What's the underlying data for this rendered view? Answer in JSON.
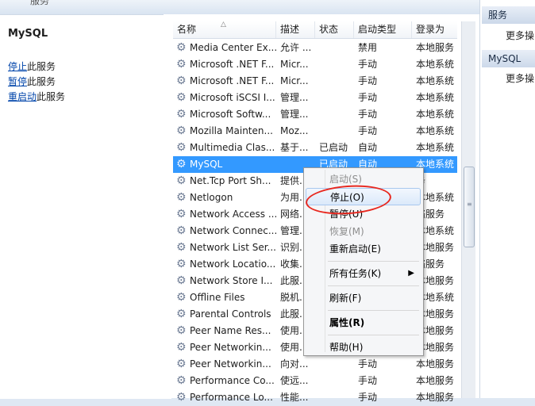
{
  "topbar": {
    "title": "服务"
  },
  "left": {
    "service_name": "MySQL",
    "actions": [
      {
        "link": "停止",
        "rest": "此服务"
      },
      {
        "link": "暂停",
        "rest": "此服务"
      },
      {
        "link": "重启动",
        "rest": "此服务"
      }
    ]
  },
  "columns": [
    "名称",
    "描述",
    "状态",
    "启动类型",
    "登录为"
  ],
  "rows": [
    {
      "name": "Media Center Ex...",
      "desc": "允许 ...",
      "status": "",
      "startup": "禁用",
      "logon": "本地服务"
    },
    {
      "name": "Microsoft .NET F...",
      "desc": "Micr...",
      "status": "",
      "startup": "手动",
      "logon": "本地系统"
    },
    {
      "name": "Microsoft .NET F...",
      "desc": "Micr...",
      "status": "",
      "startup": "手动",
      "logon": "本地系统"
    },
    {
      "name": "Microsoft iSCSI I...",
      "desc": "管理...",
      "status": "",
      "startup": "手动",
      "logon": "本地系统"
    },
    {
      "name": "Microsoft Softw...",
      "desc": "管理...",
      "status": "",
      "startup": "手动",
      "logon": "本地系统"
    },
    {
      "name": "Mozilla Mainten...",
      "desc": "Moz...",
      "status": "",
      "startup": "手动",
      "logon": "本地系统"
    },
    {
      "name": "Multimedia Clas...",
      "desc": "基于...",
      "status": "已启动",
      "startup": "自动",
      "logon": "本地系统"
    },
    {
      "name": "MySQL",
      "desc": "",
      "status": "已启动",
      "startup": "自动",
      "logon": "本地系统",
      "selected": true
    },
    {
      "name": "Net.Tcp Port Sh...",
      "desc": "提供...",
      "status": "",
      "startup": "",
      "logon": "务"
    },
    {
      "name": "Netlogon",
      "desc": "为用...",
      "status": "",
      "startup": "",
      "logon": "本地系统"
    },
    {
      "name": "Network Access ...",
      "desc": "网络...",
      "status": "",
      "startup": "",
      "logon": "络服务"
    },
    {
      "name": "Network Connec...",
      "desc": "管理...",
      "status": "",
      "startup": "",
      "logon": "本地系统"
    },
    {
      "name": "Network List Ser...",
      "desc": "识别...",
      "status": "",
      "startup": "",
      "logon": "本地服务"
    },
    {
      "name": "Network Locatio...",
      "desc": "收集...",
      "status": "",
      "startup": "",
      "logon": "络服务"
    },
    {
      "name": "Network Store I...",
      "desc": "此服...",
      "status": "",
      "startup": "",
      "logon": "本地服务"
    },
    {
      "name": "Offline Files",
      "desc": "脱机...",
      "status": "",
      "startup": "",
      "logon": "本地系统"
    },
    {
      "name": "Parental Controls",
      "desc": "此服...",
      "status": "",
      "startup": "",
      "logon": "本地服务"
    },
    {
      "name": "Peer Name Res...",
      "desc": "使用...",
      "status": "",
      "startup": "",
      "logon": "本地服务"
    },
    {
      "name": "Peer Networkin...",
      "desc": "使用...",
      "status": "",
      "startup": "",
      "logon": "本地服务"
    },
    {
      "name": "Peer Networkin...",
      "desc": "向对...",
      "status": "",
      "startup": "手动",
      "logon": "本地服务"
    },
    {
      "name": "Performance Co...",
      "desc": "使远...",
      "status": "",
      "startup": "手动",
      "logon": "本地服务"
    },
    {
      "name": "Performance Lo...",
      "desc": "性能...",
      "status": "",
      "startup": "手动",
      "logon": "本地服务"
    }
  ],
  "actions_pane": {
    "sections": [
      {
        "header": "服务",
        "more": "更多操"
      },
      {
        "header": "MySQL",
        "more": "更多操"
      }
    ]
  },
  "context_menu": [
    {
      "label": "启动(S)",
      "disabled": true
    },
    {
      "label": "停止(O)",
      "highlighted": true
    },
    {
      "label": "暂停(U)"
    },
    {
      "label": "恢复(M)",
      "disabled": true
    },
    {
      "label": "重新启动(E)"
    },
    {
      "separator": true
    },
    {
      "label": "所有任务(K)",
      "submenu": true
    },
    {
      "separator": true
    },
    {
      "label": "刷新(F)"
    },
    {
      "separator": true
    },
    {
      "label": "属性(R)",
      "bold": true
    },
    {
      "separator": true
    },
    {
      "label": "帮助(H)"
    }
  ],
  "colors": {
    "selection": "#3399ff",
    "annotation": "#e8281f",
    "link": "#0044aa"
  }
}
